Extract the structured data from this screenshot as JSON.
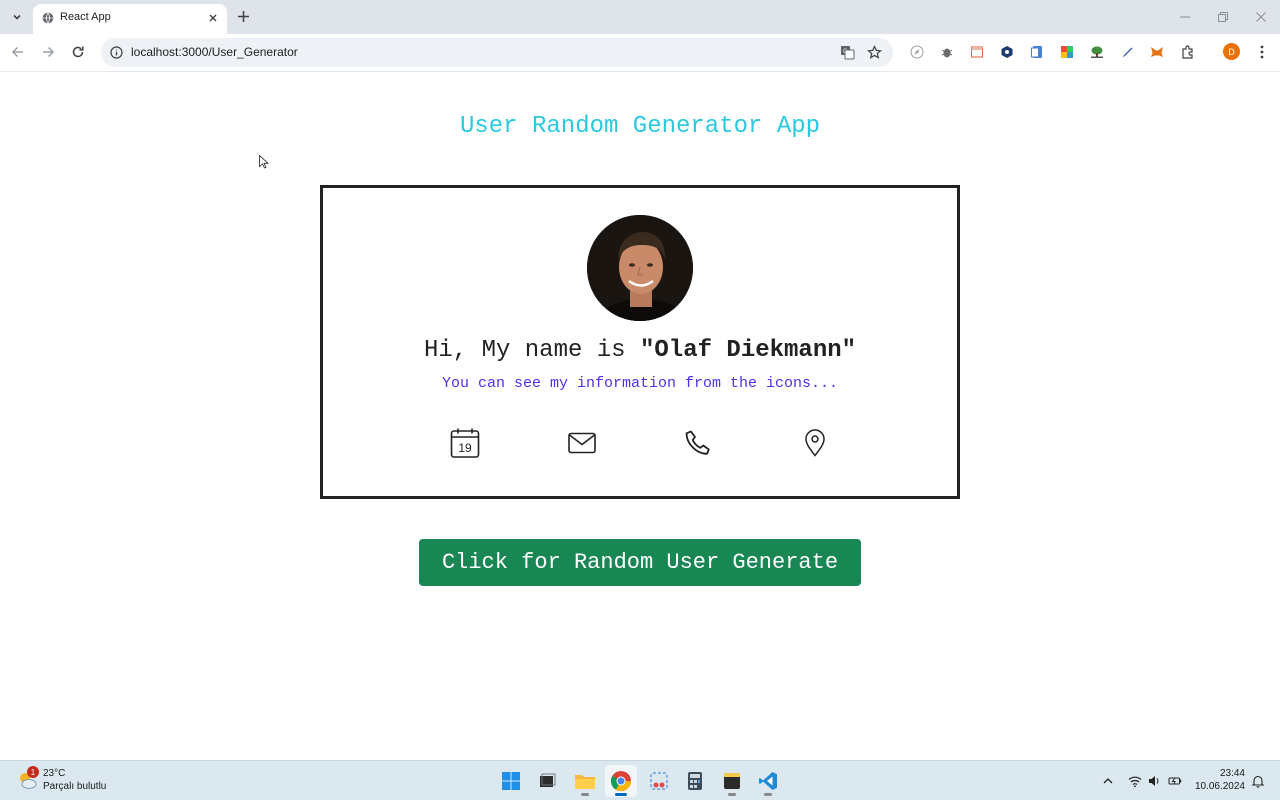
{
  "browser": {
    "tab_title": "React App",
    "url": "localhost:3000/User_Generator",
    "profile_initial": "D"
  },
  "page": {
    "app_title": "User Random Generator App",
    "greeting_prefix": "Hi, My name is ",
    "user_name": "\"Olaf Diekmann\"",
    "subtitle": "You can see my information from the icons...",
    "calendar_day": "19",
    "info_icons": [
      "calendar-icon",
      "mail-icon",
      "phone-icon",
      "location-icon"
    ],
    "generate_button": "Click for Random User Generate",
    "colors": {
      "title": "#29c9e0",
      "subtitle": "#4a33e8",
      "button": "#198754"
    }
  },
  "taskbar": {
    "weather_badge": "1",
    "temperature": "23°C",
    "weather_desc": "Parçalı bulutlu",
    "time": "23:44",
    "date": "10.06.2024"
  }
}
